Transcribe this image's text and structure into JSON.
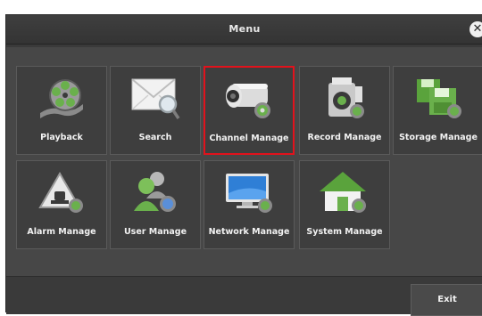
{
  "window": {
    "title": "Menu"
  },
  "menu_items": [
    {
      "label": "Playback",
      "icon": "film-reel-icon"
    },
    {
      "label": "Search",
      "icon": "envelope-magnifier-icon"
    },
    {
      "label": "Channel Manage",
      "icon": "camera-gear-icon",
      "selected": true
    },
    {
      "label": "Record Manage",
      "icon": "video-recorder-gear-icon"
    },
    {
      "label": "Storage Manage",
      "icon": "floppy-disk-gear-icon"
    },
    {
      "label": "Alarm Manage",
      "icon": "alarm-gear-icon"
    },
    {
      "label": "User Manage",
      "icon": "users-gear-icon"
    },
    {
      "label": "Network Manage",
      "icon": "monitor-gear-icon"
    },
    {
      "label": "System Manage",
      "icon": "house-gear-icon"
    }
  ],
  "footer": {
    "exit_label": "Exit"
  },
  "colors": {
    "selection_border": "#e2121c",
    "tile_bg": "#3e3e3e",
    "panel_bg": "#474747"
  }
}
